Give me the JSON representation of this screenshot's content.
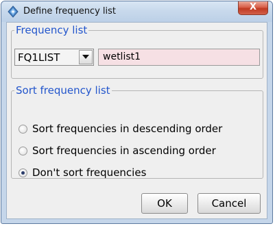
{
  "window": {
    "title": "Define frequency list",
    "close_label": "X"
  },
  "frequency_list": {
    "legend": "Frequency list",
    "combo_value": "FQ1LIST",
    "name_value": "wetlist1"
  },
  "sort": {
    "legend": "Sort frequency list",
    "options": [
      {
        "label": "Sort frequencies in descending order",
        "checked": false
      },
      {
        "label": "Sort frequencies in ascending order",
        "checked": false
      },
      {
        "label": "Don't sort frequencies",
        "checked": true
      }
    ]
  },
  "buttons": {
    "ok": "OK",
    "cancel": "Cancel"
  },
  "icons": {
    "app": "app-icon",
    "dropdown": "chevron-down-icon"
  },
  "colors": {
    "legend_blue": "#2255cc",
    "field_pink": "#f6e0e4",
    "close_red": "#c03a22"
  }
}
